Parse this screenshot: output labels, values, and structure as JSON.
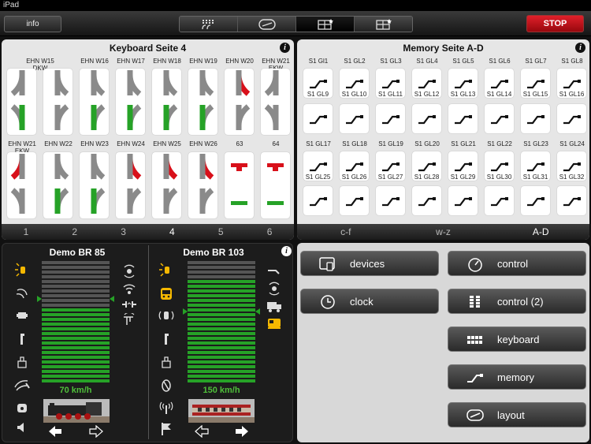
{
  "status": {
    "device": "iPad"
  },
  "toolbar": {
    "info_label": "info",
    "stop_label": "STOP"
  },
  "keyboard": {
    "title": "Keyboard Seite 4",
    "top_labels": [
      "EHN W15 DKW",
      "EHN W16",
      "EHN W17",
      "EHN W18",
      "EHN W19",
      "EHN W20",
      "EHN W21 EKW"
    ],
    "bottom_labels": [
      "EHN W21 EKW",
      "EHN W22",
      "EHN W23",
      "EHN W24",
      "EHN W25",
      "EHN W26",
      "63",
      "64"
    ],
    "tabs": [
      "1",
      "2",
      "3",
      "4",
      "5",
      "6"
    ],
    "active_tab": "4"
  },
  "memory": {
    "title": "Memory Seite A-D",
    "row1_labels": [
      "S1 Gl1",
      "S1 GL2",
      "S1 GL3",
      "S1 GL4",
      "S1 GL5",
      "S1 GL6",
      "S1 GL7",
      "S1 GL8"
    ],
    "row2_labels": [
      "S1 GL9",
      "S1 GL10",
      "S1 GL11",
      "S1 GL12",
      "S1 GL13",
      "S1 GL14",
      "S1 GL15",
      "S1 GL16"
    ],
    "row3_labels": [
      "S1 GL17",
      "S1 GL18",
      "S1 GL19",
      "S1 GL20",
      "S1 GL21",
      "S1 GL22",
      "S1 GL23",
      "S1 GL24"
    ],
    "row4_labels": [
      "S1 GL25",
      "S1 GL26",
      "S1 GL27",
      "S1 GL28",
      "S1 GL29",
      "S1 GL30",
      "S1 GL31",
      "S1 GL32"
    ],
    "tabs": [
      "c-f",
      "w-z",
      "A-D"
    ],
    "active_tab": "A-D"
  },
  "locos": [
    {
      "name": "Demo BR 85",
      "speed": "70 km/h",
      "speed_fraction": 0.62
    },
    {
      "name": "Demo BR 103",
      "speed": "150 km/h",
      "speed_fraction": 0.83
    }
  ],
  "menu": {
    "devices": "devices",
    "control": "control",
    "clock": "clock",
    "control2": "control (2)",
    "keyboard": "keyboard",
    "memory": "memory",
    "layout": "layout"
  },
  "colors": {
    "accent_green": "#26a227",
    "stop_red": "#d0101a",
    "signal_red": "#d8101a"
  }
}
